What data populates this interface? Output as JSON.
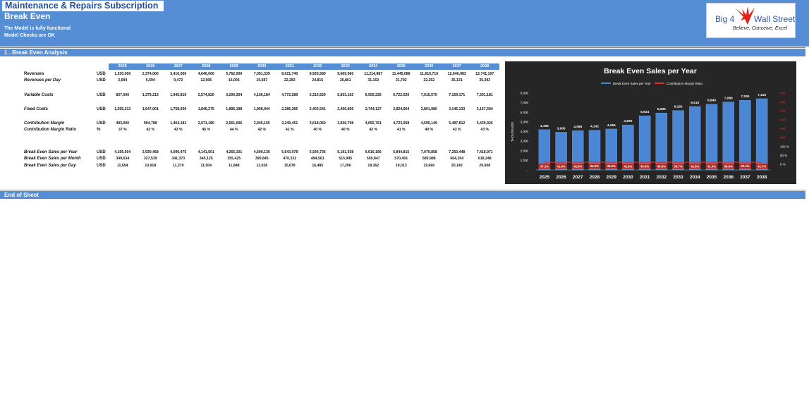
{
  "header": {
    "app_title": "Maintenance & Repairs Subscription",
    "page_title": "Break Even",
    "status_lines": [
      "The Model is fully functional",
      "Model Checks are OK"
    ],
    "logo": {
      "brand_left": "Big 4",
      "brand_right": "Wall Street",
      "tagline": "Believe, Conceive, Excel"
    }
  },
  "section": {
    "title": "1 . Break Even Analysis"
  },
  "footer": {
    "title": "End of Sheet"
  },
  "table": {
    "years": [
      "2025",
      "2026",
      "2027",
      "2028",
      "2029",
      "2030",
      "2031",
      "2032",
      "2033",
      "2034",
      "2035",
      "2036",
      "2037",
      "2038"
    ],
    "rows": [
      {
        "label": "Revenues",
        "italic": false,
        "unit": "USD",
        "values": [
          "1,330,000",
          "2,374,000",
          "3,410,000",
          "4,646,000",
          "5,762,000",
          "7,051,339",
          "8,021,740",
          "8,933,580",
          "9,669,960",
          "11,214,987",
          "11,445,088",
          "11,610,719",
          "12,646,983",
          "12,741,107"
        ]
      },
      {
        "label": "Revenues per Day",
        "italic": true,
        "unit": "USD",
        "values": [
          "3,694",
          "6,594",
          "9,472",
          "12,906",
          "16,006",
          "19,587",
          "22,283",
          "24,815",
          "26,861",
          "31,153",
          "31,792",
          "32,252",
          "35,131",
          "35,392"
        ]
      },
      {
        "label": "Variable Costs",
        "italic": true,
        "unit": "USD",
        "values": [
          "837,000",
          "1,379,213",
          "1,945,819",
          "2,574,820",
          "3,200,304",
          "4,106,184",
          "4,772,289",
          "5,315,520",
          "5,833,162",
          "6,559,226",
          "6,722,020",
          "7,015,570",
          "7,159,171",
          "7,301,181"
        ]
      },
      {
        "label": "Fixed Costs",
        "italic": true,
        "unit": "USD",
        "values": [
          "1,555,213",
          "1,647,001",
          "1,758,939",
          "1,846,275",
          "1,896,198",
          "1,958,944",
          "2,286,266",
          "2,403,541",
          "2,456,806",
          "2,744,127",
          "2,824,664",
          "2,801,980",
          "3,146,133",
          "3,167,594"
        ]
      },
      {
        "label": "Contribution Margin",
        "italic": true,
        "unit": "USD",
        "values": [
          "493,000",
          "994,788",
          "1,464,181",
          "2,071,180",
          "2,561,696",
          "2,945,155",
          "3,249,451",
          "3,618,060",
          "3,836,798",
          "4,655,761",
          "4,723,068",
          "4,595,149",
          "5,487,812",
          "5,439,926"
        ]
      },
      {
        "label": "Contribution Margin Ratio",
        "italic": true,
        "unit": "%",
        "values": [
          "37 %",
          "42 %",
          "43 %",
          "45 %",
          "44 %",
          "42 %",
          "41 %",
          "40 %",
          "40 %",
          "42 %",
          "41 %",
          "40 %",
          "43 %",
          "43 %"
        ]
      },
      {
        "label": "Break Even Sales per Year",
        "italic": true,
        "unit": "USD",
        "values": [
          "4,195,604",
          "3,930,468",
          "4,096,475",
          "4,141,501",
          "4,265,101",
          "4,690,136",
          "5,643,978",
          "5,934,736",
          "6,191,938",
          "6,610,166",
          "6,844,815",
          "7,079,858",
          "7,250,448",
          "7,418,971"
        ]
      },
      {
        "label": "Break Even Sales per Month",
        "italic": true,
        "unit": "USD",
        "values": [
          "349,634",
          "327,539",
          "341,373",
          "345,125",
          "355,425",
          "390,845",
          "470,332",
          "494,561",
          "515,995",
          "550,847",
          "570,401",
          "589,988",
          "604,204",
          "618,248"
        ]
      },
      {
        "label": "Break Even Sales per Day",
        "italic": true,
        "unit": "USD",
        "values": [
          "11,654",
          "10,918",
          "11,379",
          "11,504",
          "11,848",
          "13,028",
          "15,678",
          "16,485",
          "17,200",
          "18,362",
          "19,013",
          "19,666",
          "20,140",
          "20,608"
        ]
      }
    ]
  },
  "chart_data": {
    "type": "bar",
    "title": "Break Even Sales per Year",
    "ylabel": "THOUSANDS",
    "ylim": [
      0,
      8000
    ],
    "y_ticks": [
      "-",
      "1,000",
      "2,000",
      "3,000",
      "4,000",
      "5,000",
      "6,000",
      "7,000",
      "8,000"
    ],
    "categories": [
      "2025",
      "2026",
      "2027",
      "2028",
      "2029",
      "2030",
      "2031",
      "2032",
      "2033",
      "2034",
      "2035",
      "2036",
      "2037",
      "2038"
    ],
    "series": [
      {
        "name": "Break Even Sales per Year",
        "color": "#4a86d4",
        "values": [
          4196,
          3930,
          4096,
          4142,
          4265,
          4690,
          5644,
          5935,
          6192,
          6610,
          6845,
          7080,
          7250,
          7419
        ],
        "labels": [
          "4,196",
          "3,930",
          "4,096",
          "4,142",
          "4,265",
          "4,690",
          "5,644",
          "5,935",
          "6,192",
          "6,610",
          "6,845",
          "7,080",
          "7,250",
          "7,419"
        ]
      },
      {
        "name": "Contribution Margin Ratio",
        "color": "#e0302a",
        "values": [
          37.1,
          41.9,
          42.9,
          44.6,
          44.5,
          41.8,
          40.5,
          40.5,
          39.7,
          41.5,
          41.3,
          39.6,
          43.4,
          42.7
        ],
        "labels": [
          "37.1%",
          "41.9%",
          "42.9%",
          "44.6%",
          "44.5%",
          "41.8%",
          "40.5%",
          "40.5%",
          "39.7%",
          "41.5%",
          "41.3%",
          "39.6%",
          "43.4%",
          "42.7%"
        ]
      }
    ],
    "y2_ticks": [
      "0 %",
      "50 %",
      "100 %",
      "###",
      "###",
      "###",
      "###",
      "###",
      "###"
    ],
    "legend": "top"
  },
  "colors": {
    "header_blue": "#558ed5",
    "chart_bg": "#262626",
    "bar": "#4a86d4",
    "ratio_line": "#e0302a"
  }
}
